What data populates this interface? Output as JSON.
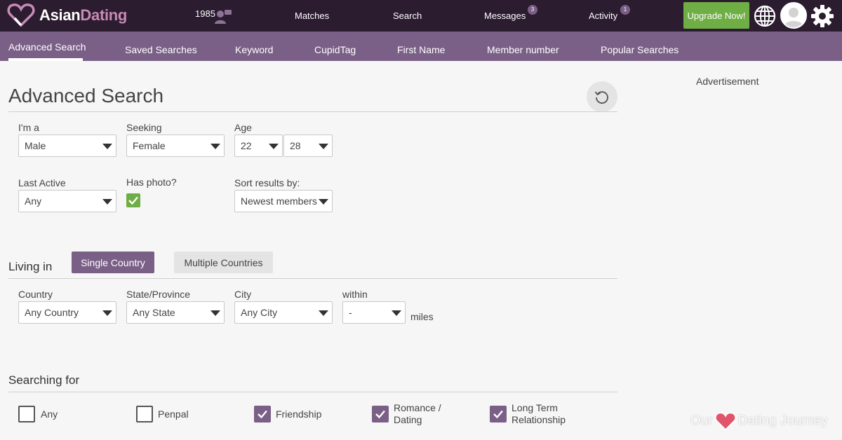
{
  "header": {
    "brand_part1": "Asian",
    "brand_part2": "Dating",
    "count": "1985",
    "nav": [
      {
        "label": "Matches"
      },
      {
        "label": "Search"
      },
      {
        "label": "Messages",
        "badge": "3"
      },
      {
        "label": "Activity",
        "badge": "1"
      }
    ],
    "upgrade_label": "Upgrade Now!",
    "colors": {
      "topbar": "#2b1c30",
      "subnav": "#7a5f87",
      "upgrade": "#6fae45"
    }
  },
  "subnav": {
    "items": [
      {
        "label": "Advanced Search",
        "active": true
      },
      {
        "label": "Saved Searches"
      },
      {
        "label": "Keyword"
      },
      {
        "label": "CupidTag"
      },
      {
        "label": "First Name"
      },
      {
        "label": "Member number"
      },
      {
        "label": "Popular Searches"
      }
    ]
  },
  "page": {
    "title": "Advanced Search",
    "advertisement": "Advertisement"
  },
  "filters": {
    "im_a": {
      "label": "I'm a",
      "value": "Male"
    },
    "seeking": {
      "label": "Seeking",
      "value": "Female"
    },
    "age": {
      "label": "Age",
      "min": "22",
      "max": "28"
    },
    "last_active": {
      "label": "Last Active",
      "value": "Any"
    },
    "has_photo": {
      "label": "Has photo?",
      "checked": true
    },
    "sort": {
      "label": "Sort results by:",
      "value": "Newest members"
    }
  },
  "living": {
    "title": "Living in",
    "single_label": "Single Country",
    "multiple_label": "Multiple Countries",
    "country": {
      "label": "Country",
      "value": "Any Country"
    },
    "state": {
      "label": "State/Province",
      "value": "Any State"
    },
    "city": {
      "label": "City",
      "value": "Any City"
    },
    "within": {
      "label": "within",
      "value": "-",
      "unit": "miles"
    }
  },
  "searching_for": {
    "title": "Searching for",
    "options": [
      {
        "label": "Any",
        "checked": false
      },
      {
        "label": "Penpal",
        "checked": false
      },
      {
        "label": "Friendship",
        "checked": true
      },
      {
        "label_line1": "Romance /",
        "label_line2": "Dating",
        "checked": true
      },
      {
        "label_line1": "Long Term",
        "label_line2": "Relationship",
        "checked": true
      }
    ]
  },
  "watermark": {
    "part1": "Our",
    "part2": "Dating Journey"
  }
}
